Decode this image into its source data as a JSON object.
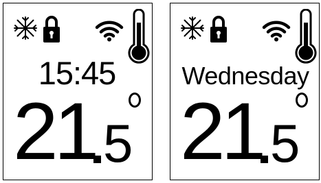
{
  "screens": [
    {
      "secondary": "15:45",
      "temperature_int": "21",
      "temperature_dec": "5",
      "icons": [
        "snowflake-icon",
        "lock-icon",
        "wifi-icon",
        "thermometer-icon"
      ]
    },
    {
      "secondary": "Wednesday",
      "temperature_int": "21",
      "temperature_dec": "5",
      "icons": [
        "snowflake-icon",
        "lock-icon",
        "wifi-icon",
        "thermometer-icon"
      ]
    }
  ],
  "colors": {
    "foreground": "#000000",
    "background": "#ffffff"
  }
}
